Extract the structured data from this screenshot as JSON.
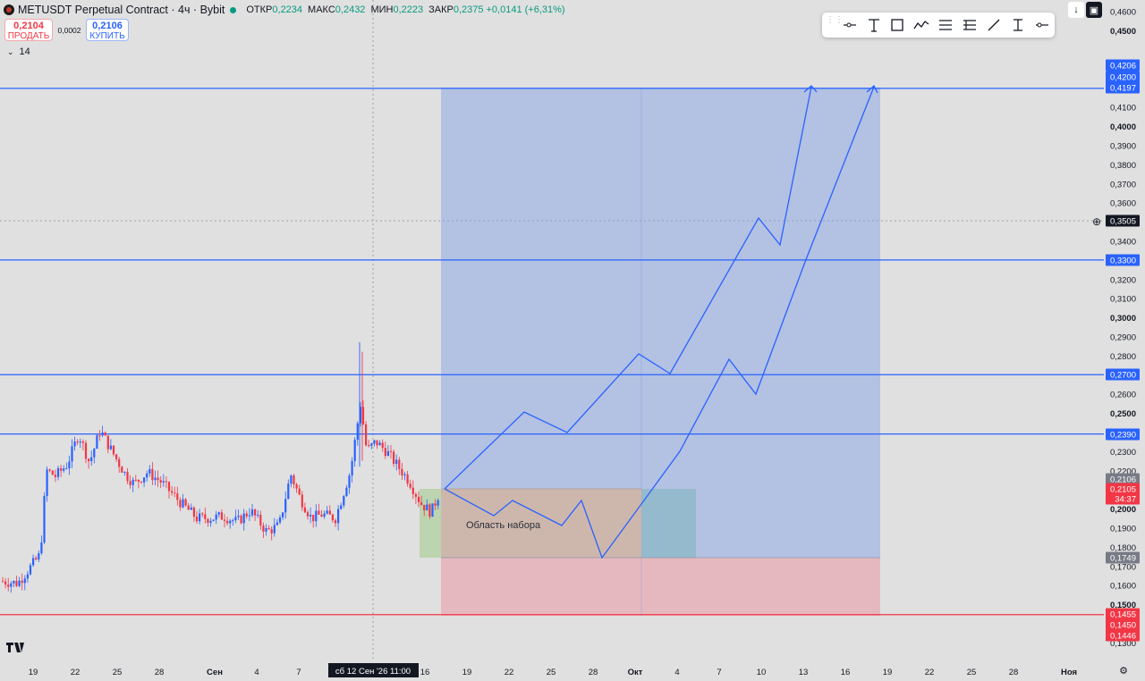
{
  "header": {
    "title": "METUSDT Perpetual Contract · 4ч · Bybit",
    "ohlc": [
      {
        "label": "ОТКР",
        "value": "0,2234"
      },
      {
        "label": "МАКС",
        "value": "0,2432"
      },
      {
        "label": "МИН",
        "value": "0,2223"
      },
      {
        "label": "ЗАКР",
        "value": "0,2375"
      }
    ],
    "change": "+0,0141 (+6,31%)",
    "status_color": "#089981"
  },
  "trade": {
    "sell_price": "0,2104",
    "sell_label": "ПРОДАТЬ",
    "spread": "0,0002",
    "buy_price": "0,2106",
    "buy_label": "КУПИТЬ"
  },
  "indicator": {
    "label": "14",
    "icon": "chevron-down-icon"
  },
  "toolbar": {
    "items": [
      {
        "name": "horizontal-ray-tool-icon"
      },
      {
        "name": "text-tool-icon"
      },
      {
        "name": "rectangle-tool-icon"
      },
      {
        "name": "path-tool-icon"
      },
      {
        "name": "fib-retracement-tool-icon"
      },
      {
        "name": "long-position-tool-icon"
      },
      {
        "name": "trend-line-tool-icon"
      },
      {
        "name": "price-range-tool-icon"
      },
      {
        "name": "horizontal-line-tool-icon"
      }
    ]
  },
  "price_axis": {
    "ticks": [
      "0,4600",
      "0,4500",
      "0,4100",
      "0,4000",
      "0,3900",
      "0,3800",
      "0,3700",
      "0,3600",
      "0,3400",
      "0,3200",
      "0,3100",
      "0,3000",
      "0,2900",
      "0,2800",
      "0,2600",
      "0,2500",
      "0,2300",
      "0,2200",
      "0,2000",
      "0,1900",
      "0,1800",
      "0,1700",
      "0,1600",
      "0,1500",
      "0,1300"
    ],
    "bold_ticks": [
      "0,4500",
      "0,4000",
      "0,3000",
      "0,2500",
      "0,2000",
      "0,1500"
    ],
    "badges": [
      {
        "text": "0,4206",
        "color": "#2962ff"
      },
      {
        "text": "0,4200",
        "color": "#2962ff"
      },
      {
        "text": "0,4197",
        "color": "#2962ff"
      },
      {
        "text": "0,3505",
        "color": "#131722"
      },
      {
        "text": "0,3300",
        "color": "#2962ff"
      },
      {
        "text": "0,2700",
        "color": "#2962ff"
      },
      {
        "text": "0,2390",
        "color": "#2962ff"
      },
      {
        "text": "0,2106",
        "color": "#787b86"
      },
      {
        "text": "0,2105",
        "color": "#f23645"
      },
      {
        "text": "34:37",
        "color": "#f23645"
      },
      {
        "text": "0,1749",
        "color": "#787b86"
      },
      {
        "text": "0,1455",
        "color": "#f23645"
      },
      {
        "text": "0,1450",
        "color": "#f23645"
      },
      {
        "text": "0,1446",
        "color": "#f23645"
      }
    ]
  },
  "time_axis": {
    "labels": [
      "19",
      "22",
      "25",
      "28",
      "Сен",
      "4",
      "7",
      "16",
      "19",
      "22",
      "25",
      "28",
      "Окт",
      "4",
      "7",
      "10",
      "13",
      "16",
      "19",
      "22",
      "25",
      "28",
      "Ноя"
    ],
    "bold_labels": [
      "Сен",
      "Окт",
      "Ноя"
    ],
    "crosshair_label": "сб 12 Сен '26   11:00"
  },
  "chart_data": {
    "type": "candlestick",
    "series_name": "METUSDT",
    "up_color": "#2962ff",
    "down_color": "#f23645",
    "horizontal_levels": [
      {
        "price": 0.4197,
        "color": "#2962ff"
      },
      {
        "price": 0.33,
        "color": "#2962ff"
      },
      {
        "price": 0.27,
        "color": "#2962ff"
      },
      {
        "price": 0.239,
        "color": "#2962ff"
      },
      {
        "price": 0.145,
        "color": "#f23645"
      }
    ],
    "position": {
      "type": "long",
      "entry": 0.2106,
      "target": 0.4197,
      "stop": 0.145,
      "target_color": "#7f9fe8",
      "stop_color": "#e8a3ae"
    },
    "accumulation_zone_label": "Область набора",
    "accumulation_zone_top": 0.2106,
    "accumulation_zone_bottom": 0.1749,
    "crosshair_price": "0,3505",
    "annotations": [
      "Область набора"
    ]
  },
  "footer": {
    "logo": "TV",
    "settings_icon": "gear-icon"
  }
}
